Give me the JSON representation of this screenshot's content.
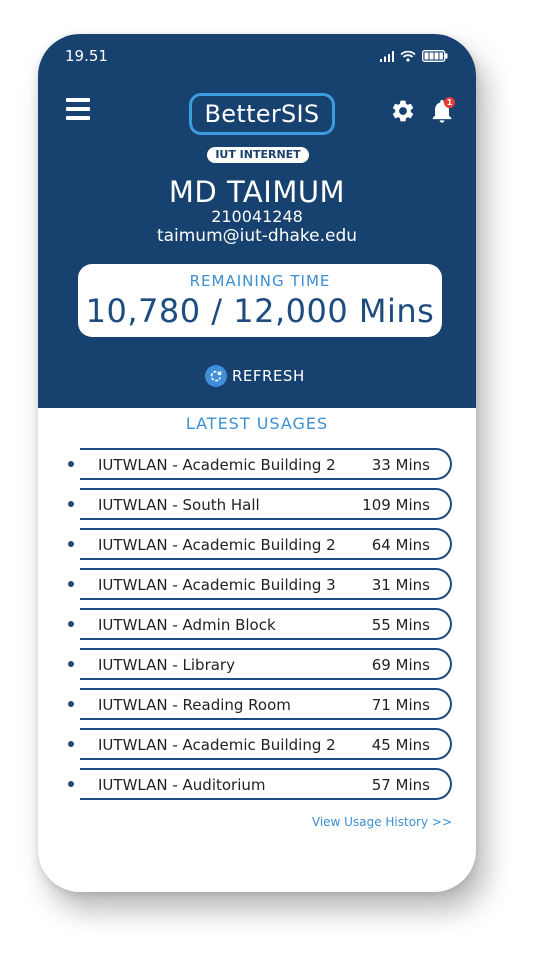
{
  "status_bar": {
    "time": "19.51"
  },
  "header": {
    "brand": "BetterSIS",
    "notification_count": "1",
    "section_pill": "IUT INTERNET"
  },
  "user": {
    "name": "MD TAIMUM",
    "id": "210041248",
    "email": "taimum@iut-dhake.edu"
  },
  "remaining": {
    "label": "REMAINING TIME",
    "value": "10,780 / 12,000 Mins"
  },
  "refresh_label": "REFRESH",
  "usages": {
    "title": "LATEST USAGES",
    "items": [
      {
        "location": "IUTWLAN - Academic Building 2",
        "minutes": "33 Mins"
      },
      {
        "location": "IUTWLAN - South Hall",
        "minutes": "109 Mins"
      },
      {
        "location": "IUTWLAN - Academic Building 2",
        "minutes": "64 Mins"
      },
      {
        "location": "IUTWLAN - Academic Building 3",
        "minutes": "31 Mins"
      },
      {
        "location": "IUTWLAN - Admin Block",
        "minutes": "55 Mins"
      },
      {
        "location": "IUTWLAN - Library",
        "minutes": "69 Mins"
      },
      {
        "location": "IUTWLAN - Reading Room",
        "minutes": "71 Mins"
      },
      {
        "location": "IUTWLAN - Academic Building 2",
        "minutes": "45 Mins"
      },
      {
        "location": "IUTWLAN - Auditorium",
        "minutes": "57 Mins"
      }
    ],
    "history_link": "View Usage History >>"
  },
  "colors": {
    "header_bg": "#17416f",
    "accent": "#3c8fd0",
    "row_border": "#1d4c80",
    "badge": "#e53935"
  },
  "icons": [
    "menu-icon",
    "gear-icon",
    "bell-icon",
    "refresh-icon",
    "signal-icon",
    "wifi-icon",
    "battery-icon"
  ]
}
